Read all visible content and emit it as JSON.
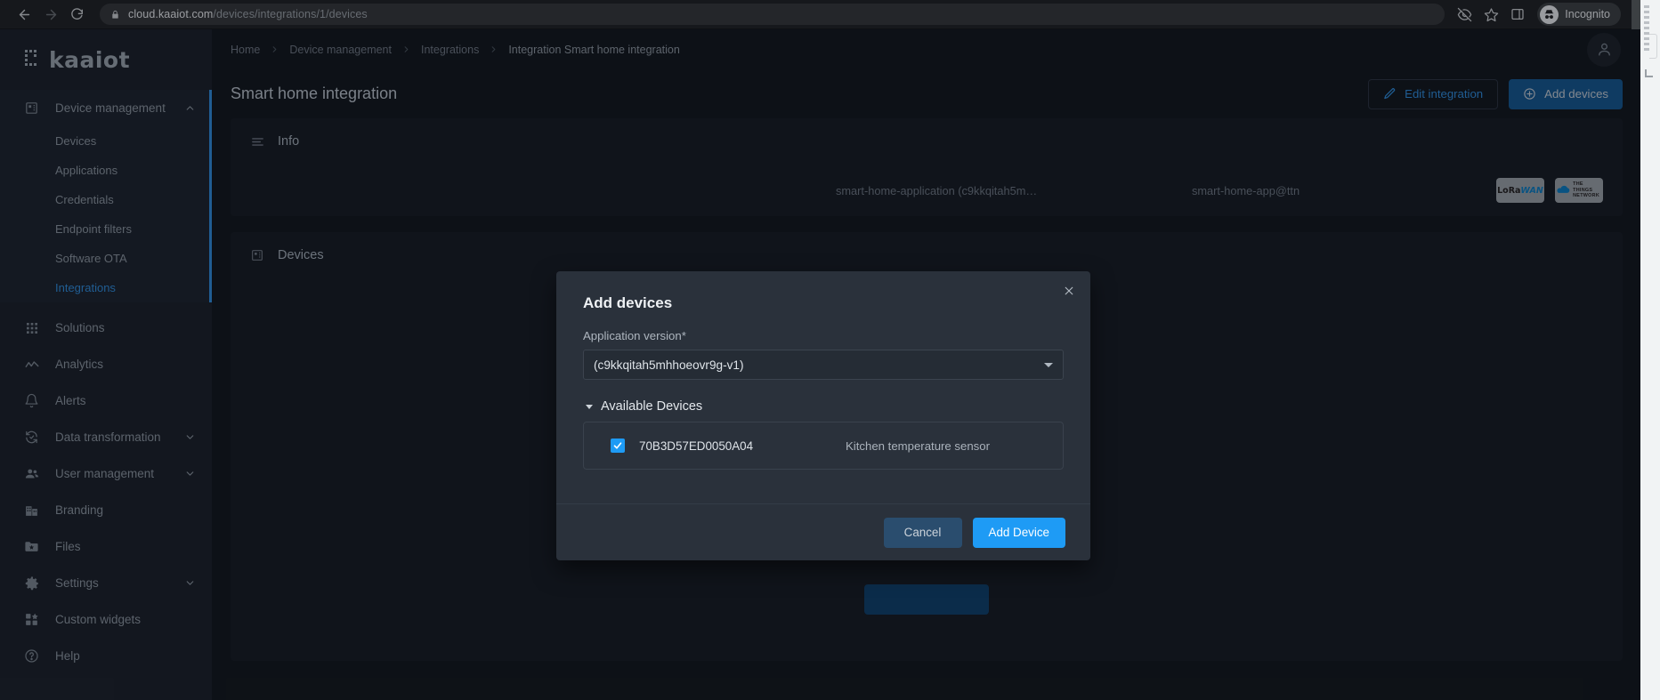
{
  "browser": {
    "url_domain": "cloud.kaaiot.com",
    "url_path": "/devices/integrations/1/devices",
    "profile_label": "Incognito",
    "back_icon": "back-arrow-icon",
    "forward_icon": "forward-arrow-icon",
    "reload_icon": "reload-icon",
    "lock_icon": "lock-icon",
    "eye_off_icon": "eye-off-icon",
    "star_icon": "star-icon",
    "sidepanel_icon": "side-panel-icon",
    "menu_icon": "kebab-menu-icon"
  },
  "sidebar": {
    "logo_text": "kaaiot",
    "groups": [
      {
        "label": "Device management",
        "icon": "chip-icon",
        "expanded": true,
        "chevron": "chevron-up-icon",
        "children": [
          {
            "label": "Devices",
            "selected": false
          },
          {
            "label": "Applications",
            "selected": false
          },
          {
            "label": "Credentials",
            "selected": false
          },
          {
            "label": "Endpoint filters",
            "selected": false
          },
          {
            "label": "Software OTA",
            "selected": false
          },
          {
            "label": "Integrations",
            "selected": true
          }
        ]
      }
    ],
    "items": [
      {
        "label": "Solutions",
        "icon": "grid-icon",
        "chevron": null
      },
      {
        "label": "Analytics",
        "icon": "analytics-icon",
        "chevron": null
      },
      {
        "label": "Alerts",
        "icon": "bell-icon",
        "chevron": null
      },
      {
        "label": "Data transformation",
        "icon": "transform-icon",
        "chevron": "chevron-down-icon"
      },
      {
        "label": "User management",
        "icon": "users-icon",
        "chevron": "chevron-down-icon"
      },
      {
        "label": "Branding",
        "icon": "building-icon",
        "chevron": null
      },
      {
        "label": "Files",
        "icon": "folder-star-icon",
        "chevron": null
      },
      {
        "label": "Settings",
        "icon": "gear-icon",
        "chevron": "chevron-down-icon"
      },
      {
        "label": "Custom widgets",
        "icon": "widgets-icon",
        "chevron": null
      },
      {
        "label": "Help",
        "icon": "help-circle-icon",
        "chevron": null
      }
    ]
  },
  "breadcrumb": {
    "items": [
      "Home",
      "Device management",
      "Integrations",
      "Integration Smart home integration"
    ],
    "separator_icon": "chevron-right-icon"
  },
  "header": {
    "title": "Smart home integration",
    "avatar_icon": "user-avatar-icon",
    "edit_button": {
      "label": "Edit integration",
      "icon": "pencil-icon"
    },
    "add_button": {
      "label": "Add devices",
      "icon": "plus-circle-icon"
    }
  },
  "info_card": {
    "title": "Info",
    "icon": "list-icon",
    "application": "smart-home-application (c9kkqitah5m…",
    "app_identifier": "smart-home-app@ttn",
    "badges": [
      {
        "name": "lorawan-badge",
        "part1": "LoRa",
        "part2": "WAN"
      },
      {
        "name": "things-network-badge",
        "line1": "THE THINGS",
        "line2": "NETWORK"
      }
    ]
  },
  "devices_card": {
    "title": "Devices",
    "icon": "chip-icon"
  },
  "modal": {
    "title": "Add devices",
    "close_icon": "close-icon",
    "field_label": "Application version*",
    "select_value": "(c9kkqitah5mhhoeovr9g-v1)",
    "select_caret_icon": "caret-down-icon",
    "section_label": "Available Devices",
    "section_caret_icon": "caret-down-icon",
    "devices": [
      {
        "checked": true,
        "id": "70B3D57ED0050A04",
        "name": "Kitchen temperature sensor"
      }
    ],
    "cancel_label": "Cancel",
    "submit_label": "Add Device"
  },
  "colors": {
    "accent_blue": "#2e8ada",
    "primary_button": "#15568f",
    "modal_primary": "#1e9bf5",
    "sidebar_bg": "#1b2029",
    "main_bg": "#12161c",
    "card_bg": "#161b22",
    "modal_bg": "#2a313b"
  }
}
